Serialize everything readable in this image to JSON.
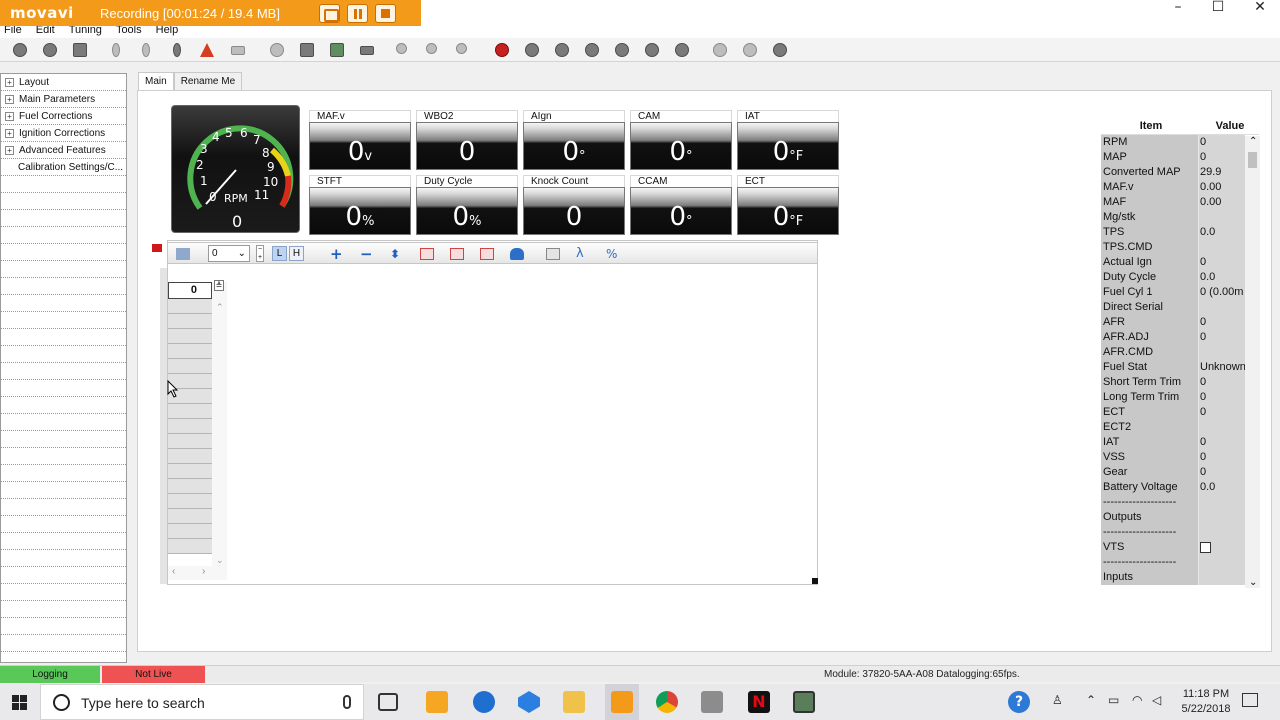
{
  "recorder": {
    "brand": "movavi",
    "status": "Recording   [00:01:24 / 19.4 MB]"
  },
  "window": {
    "controls": [
      "–",
      "☐",
      "✕"
    ]
  },
  "menu": [
    "File",
    "Edit",
    "Tuning",
    "Tools",
    "Help"
  ],
  "toolbar_icons": [
    "connect-icon",
    "disconnect-icon",
    "save-icon",
    "probe-icon",
    "down-arrow-icon",
    "up-arrow-icon",
    "warning-icon",
    "device-icon",
    "tools-icon",
    "floppy-icon",
    "floppy-green-icon",
    "chip-icon",
    "zoom-icon",
    "zoom-in-icon",
    "zoom-out-icon",
    "record-icon",
    "rewind-icon",
    "back-icon",
    "play-icon",
    "pause-icon",
    "forward-icon",
    "end-icon",
    "user-icon",
    "settings-icon",
    "help-icon"
  ],
  "tree": {
    "items": [
      {
        "label": "Layout",
        "expandable": true
      },
      {
        "label": "Main Parameters",
        "expandable": true
      },
      {
        "label": "Fuel Corrections",
        "expandable": true
      },
      {
        "label": "Ignition Corrections",
        "expandable": true
      },
      {
        "label": "Advanced Features",
        "expandable": true
      },
      {
        "label": "Calibration Settings/C...",
        "expandable": false
      }
    ]
  },
  "tabs": [
    "Main",
    "Rename Me"
  ],
  "gauge": {
    "ticks": [
      "0",
      "1",
      "2",
      "3",
      "4",
      "5",
      "6",
      "7",
      "8",
      "9",
      "10",
      "11"
    ],
    "unit": "RPM",
    "value": "0",
    "level": 0
  },
  "tiles": [
    {
      "label": "MAF.v",
      "value": "0",
      "unit": "v"
    },
    {
      "label": "WBO2",
      "value": "0",
      "unit": ""
    },
    {
      "label": "AIgn",
      "value": "0",
      "unit": "°"
    },
    {
      "label": "CAM",
      "value": "0",
      "unit": "°"
    },
    {
      "label": "IAT",
      "value": "0",
      "unit": "°F"
    },
    {
      "label": "STFT",
      "value": "0",
      "unit": "%"
    },
    {
      "label": "Duty Cycle",
      "value": "0",
      "unit": "%"
    },
    {
      "label": "Knock Count",
      "value": "0",
      "unit": ""
    },
    {
      "label": "CCAM",
      "value": "0",
      "unit": "°"
    },
    {
      "label": "ECT",
      "value": "0",
      "unit": "°F"
    }
  ],
  "table_toolbar": {
    "select_value": "0",
    "toggle_l": "L",
    "toggle_h": "H",
    "lambda": "λ",
    "percent": "%"
  },
  "grid": {
    "header": "0"
  },
  "values_table": {
    "headers": [
      "Item",
      "Value"
    ],
    "rows": [
      {
        "item": "RPM",
        "value": "0"
      },
      {
        "item": "MAP",
        "value": "0"
      },
      {
        "item": "Converted MAP",
        "value": "29.9"
      },
      {
        "item": "MAF.v",
        "value": "0.00"
      },
      {
        "item": "MAF",
        "value": "0.00"
      },
      {
        "item": "Mg/stk",
        "value": ""
      },
      {
        "item": "TPS",
        "value": "0.0"
      },
      {
        "item": "TPS.CMD",
        "value": ""
      },
      {
        "item": "Actual Ign",
        "value": "0"
      },
      {
        "item": "Duty Cycle",
        "value": "0.0"
      },
      {
        "item": "Fuel Cyl 1",
        "value": "0  (0.00m"
      },
      {
        "item": "Direct Serial",
        "value": ""
      },
      {
        "item": "AFR",
        "value": "0"
      },
      {
        "item": "AFR.ADJ",
        "value": "0"
      },
      {
        "item": "AFR.CMD",
        "value": ""
      },
      {
        "item": "Fuel Stat",
        "value": "Unknown"
      },
      {
        "item": "Short Term Trim",
        "value": "0"
      },
      {
        "item": "Long Term Trim",
        "value": "0"
      },
      {
        "item": "ECT",
        "value": "0"
      },
      {
        "item": "ECT2",
        "value": ""
      },
      {
        "item": "IAT",
        "value": "0"
      },
      {
        "item": "VSS",
        "value": "0"
      },
      {
        "item": "Gear",
        "value": "0"
      },
      {
        "item": "Battery Voltage",
        "value": "0.0"
      },
      {
        "item": "--------------------",
        "value": ""
      },
      {
        "item": "Outputs",
        "value": ""
      },
      {
        "item": "--------------------",
        "value": ""
      },
      {
        "item": "VTS",
        "value": "",
        "checkbox": true
      },
      {
        "item": "--------------------",
        "value": ""
      },
      {
        "item": "Inputs",
        "value": ""
      }
    ]
  },
  "status": {
    "logging": "Logging",
    "live": "Not Live",
    "module": "Module: 37820-5AA-A08 Datalogging:65fps."
  },
  "taskbar": {
    "search_placeholder": "Type here to search",
    "time": "11:18 PM",
    "date": "5/22/2018"
  },
  "colors": {
    "recorder": "#f39a1a",
    "logging": "#59c859",
    "not_live": "#ee5252",
    "tile_black": "#0a0a0a"
  }
}
